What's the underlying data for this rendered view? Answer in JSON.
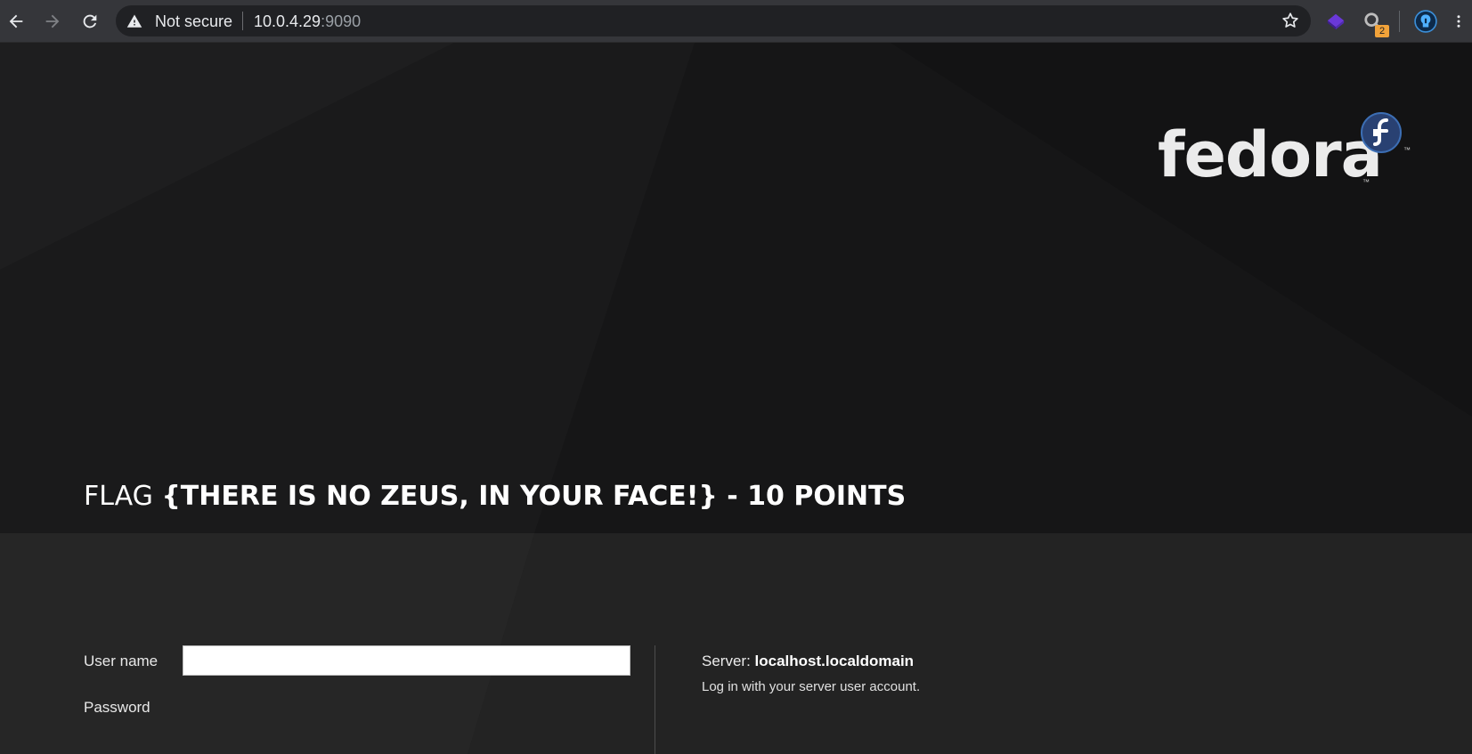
{
  "browser": {
    "security_label": "Not secure",
    "url_host": "10.0.4.29",
    "url_port": ":9090",
    "extension_badge": "2"
  },
  "brand": {
    "wordmark": "fedora",
    "tm": "™"
  },
  "login": {
    "flag_prefix": "FLAG",
    "flag_value": "{THERE IS NO ZEUS, IN YOUR FACE!} - 10 POINTS",
    "username_label": "User name",
    "username_value": "",
    "password_label": "Password",
    "server_label": "Server:",
    "server_name": "localhost.localdomain",
    "help_text": "Log in with your server user account."
  },
  "colors": {
    "hero_bg": "#161617",
    "login_bg": "#242424",
    "chrome_bg": "#35363a",
    "fedora_blue": "#294172"
  }
}
